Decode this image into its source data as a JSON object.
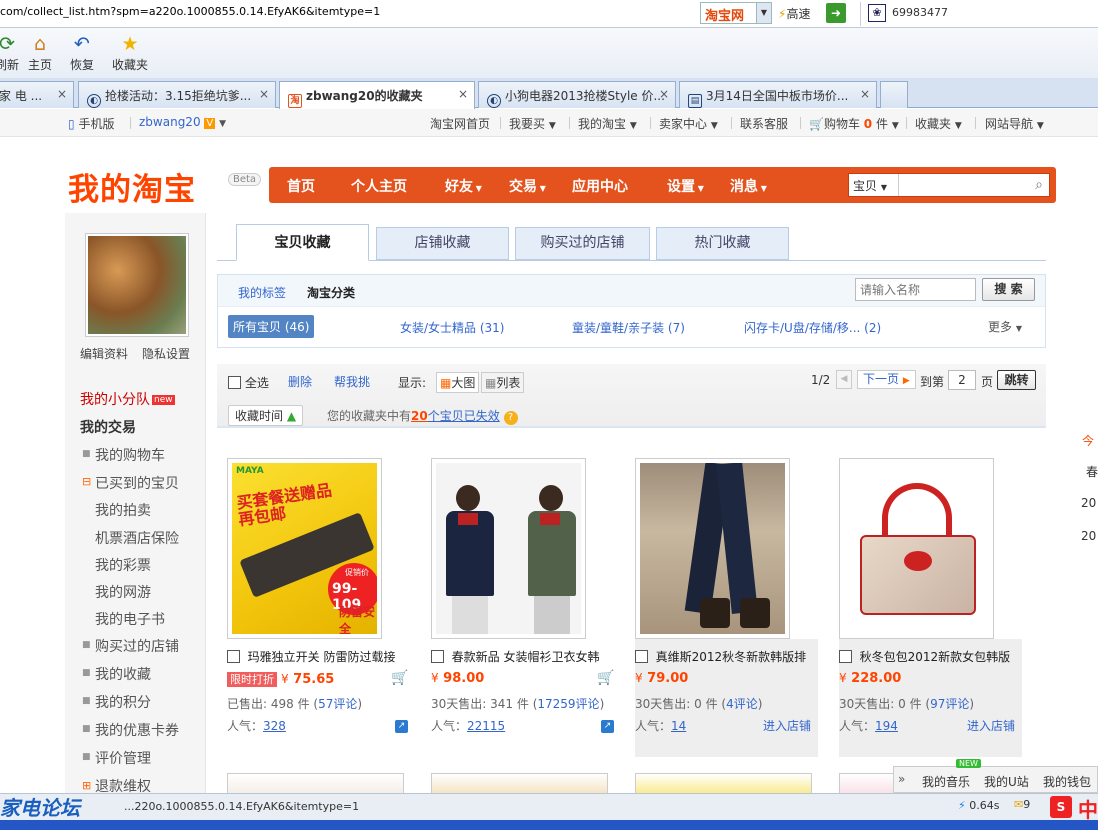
{
  "browser": {
    "url": "com/collect_list.htm?spm=a220o.1000855.0.14.EfyAK6&itemtype=1",
    "engine": "淘宝网",
    "speed_label": "高速",
    "counter": "69983477",
    "toolbar": [
      {
        "label": "刷新",
        "icon": "refresh-icon"
      },
      {
        "label": "主页",
        "icon": "home-icon"
      },
      {
        "label": "恢复",
        "icon": "undo-icon"
      },
      {
        "label": "收藏夹",
        "icon": "star-icon"
      }
    ],
    "tabs": [
      {
        "title": "家 电 ..."
      },
      {
        "title": "抢楼活动：3.15拒绝坑爹..."
      },
      {
        "title": "zbwang20的收藏夹",
        "active": true
      },
      {
        "title": "小狗电器2013抢楼Style 价..."
      },
      {
        "title": "3月14日全国中板市场价..."
      }
    ],
    "status_url": "...220o.1000855.0.14.EfyAK6&itemtype=1",
    "load_time": "0.64s",
    "mail_count": "9",
    "watermark": "家电论坛"
  },
  "topnav": {
    "mobile": "手机版",
    "user": "zbwang20",
    "items": [
      "淘宝网首页",
      "我要买",
      "我的淘宝",
      "卖家中心",
      "联系客服",
      "购物车",
      "收藏夹",
      "网站导航"
    ],
    "cart_count": "0",
    "cart_unit": "件"
  },
  "header": {
    "logo": "我的淘宝",
    "beta": "Beta",
    "nav": [
      "首页",
      "个人主页",
      "好友",
      "交易",
      "应用中心",
      "设置",
      "消息"
    ],
    "search_scope": "宝贝"
  },
  "sidebar": {
    "edit_profile": "编辑资料",
    "privacy": "隐私设置",
    "team": "我的小分队",
    "team_badge": "new",
    "trade_title": "我的交易",
    "items": [
      "我的购物车",
      "已买到的宝贝",
      "我的拍卖",
      "机票酒店保险",
      "我的彩票",
      "我的网游",
      "我的电子书",
      "购买过的店铺",
      "我的收藏",
      "我的积分",
      "我的优惠卡券",
      "评价管理",
      "退款维权"
    ]
  },
  "content": {
    "tabs": [
      "宝贝收藏",
      "店铺收藏",
      "购买过的店铺",
      "热门收藏"
    ],
    "filter": {
      "my_tags": "我的标签",
      "taobao_cat": "淘宝分类",
      "search_placeholder": "请输入名称",
      "search_btn": "搜 索",
      "cats": [
        "所有宝贝 (46)",
        "女装/女士精品 (31)",
        "童装/童鞋/亲子装 (7)",
        "闪存卡/U盘/存储/移... (2)"
      ],
      "more": "更多"
    },
    "ops": {
      "select_all": "全选",
      "delete": "删除",
      "help_pick": "帮我挑",
      "display": "显示:",
      "big": "大图",
      "list": "列表",
      "page": "1/2",
      "next": "下一页",
      "goto": "到第",
      "goto_page": "2",
      "page_unit": "页",
      "jump": "跳转",
      "sort": "收藏时间",
      "notice_pre": "您的收藏夹中有",
      "notice_num": "20",
      "notice_post": "个宝贝已失效"
    },
    "products": [
      {
        "name": "玛雅独立开关 防雷防过载接",
        "tag": "限时打折",
        "price": "75.65",
        "sold": "已售出: 498 件",
        "reviews": "57评论",
        "pop": "328",
        "shop": "",
        "promo1": "买套餐送赠品",
        "promo2": "再包邮",
        "promo3": "促销价",
        "promo4": "99-109",
        "promo5": "防雷安全",
        "brand": "MAYA"
      },
      {
        "name": "春款新品 女装帽衫卫衣女韩",
        "tag": "",
        "price": "98.00",
        "sold": "30天售出: 341 件",
        "reviews": "17259评论",
        "pop": "22115",
        "shop": ""
      },
      {
        "name": "真维斯2012秋冬新款韩版排",
        "tag": "",
        "price": "79.00",
        "sold": "30天售出: 0 件",
        "reviews": "4评论",
        "pop": "14",
        "shop": "进入店铺"
      },
      {
        "name": "秋冬包包2012新款女包韩版",
        "tag": "",
        "price": "228.00",
        "sold": "30天售出: 0 件",
        "reviews": "97评论",
        "pop": "194",
        "shop": "进入店铺"
      }
    ],
    "labels": {
      "yen": "¥",
      "pop": "人气：",
      "lp": "(",
      "rp": ")"
    }
  },
  "music": {
    "items": [
      "我的音乐",
      "我的U站",
      "我的钱包"
    ],
    "badge": "NEW"
  },
  "right_edge": [
    "今",
    "春",
    "20",
    "20"
  ]
}
